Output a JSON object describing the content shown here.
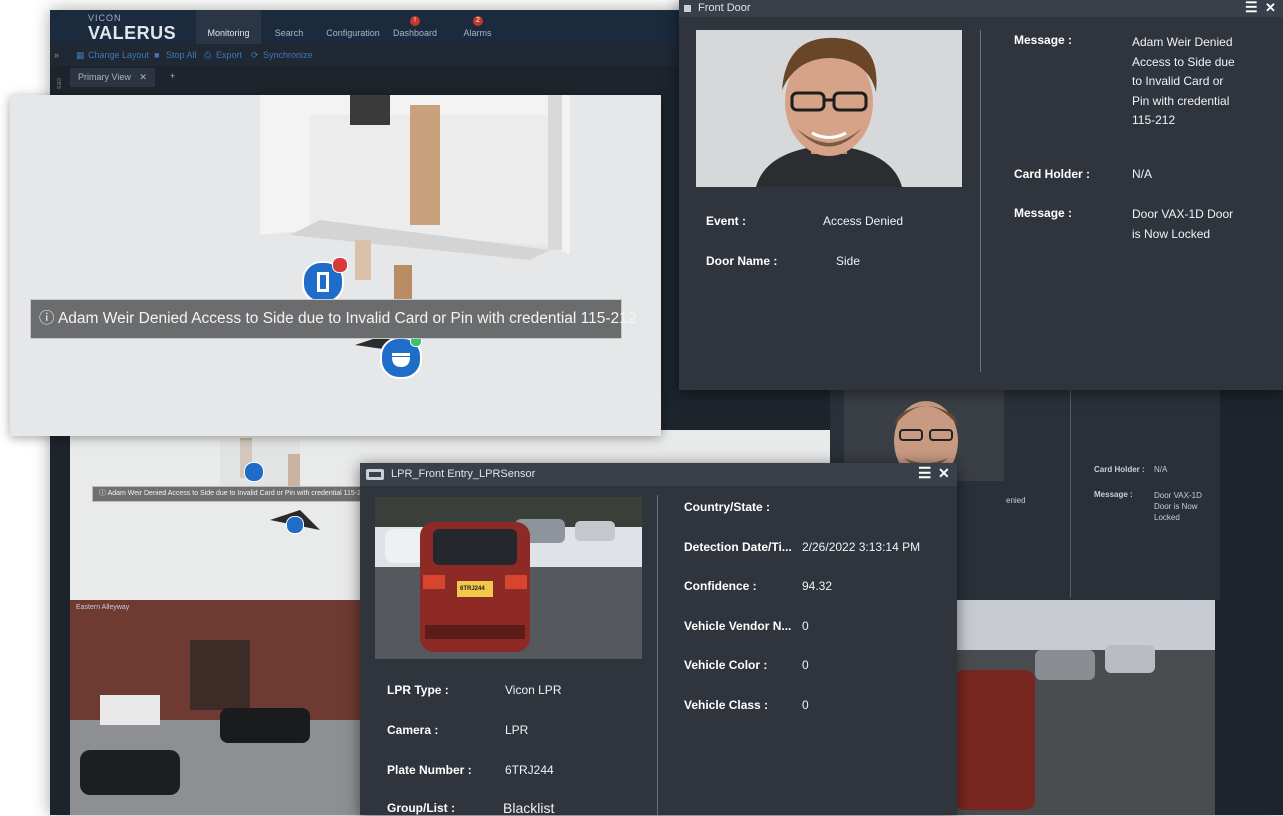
{
  "app": {
    "brand_top": "VICON",
    "brand_main": "VALERUS",
    "nav": [
      "Monitoring",
      "Search",
      "Configuration",
      "Dashboard",
      "Alarms"
    ],
    "alarm_count": "2",
    "toolbar": [
      "Change Layout",
      "Stop All",
      "Export",
      "Synchronize"
    ],
    "view_tab": "Primary View",
    "camera_label": "Eastern Alleyway",
    "side_label": "ces"
  },
  "map": {
    "tooltip": "Adam Weir Denied Access to Side due to Invalid Card or Pin with credential 115-212"
  },
  "bg_panel": {
    "msg_value": "Side due to Invalid Card or Pin with credential 115-212",
    "card_holder_label": "Card Holder :",
    "card_holder_value": "N/A",
    "message_label": "Message :",
    "message_value": "Door VAX-1D Door is Now Locked",
    "partial_text": "enied"
  },
  "front_door": {
    "title": "Front Door",
    "event_label": "Event :",
    "event_value": "Access Denied",
    "door_name_label": "Door Name :",
    "door_name_value": "Side",
    "message_label": "Message :",
    "message_value": "Adam Weir Denied Access to Side due to Invalid Card or Pin with credential 115-212",
    "card_holder_label": "Card Holder :",
    "card_holder_value": "N/A",
    "message2_label": "Message :",
    "message2_value": "Door VAX-1D Door is Now Locked"
  },
  "lpr": {
    "title": "LPR_Front Entry_LPRSensor",
    "plate_on_photo": "6TRJ244",
    "left_fields": [
      {
        "label": "LPR Type :",
        "value": "Vicon LPR"
      },
      {
        "label": "Camera :",
        "value": "LPR"
      },
      {
        "label": "Plate Number :",
        "value": "6TRJ244"
      },
      {
        "label": "Group/List :",
        "value": "Blacklist"
      }
    ],
    "right_fields": [
      {
        "label": "Country/State :",
        "value": ""
      },
      {
        "label": "Detection Date/Ti...",
        "value": "2/26/2022 3:13:14 PM"
      },
      {
        "label": "Confidence :",
        "value": "94.32"
      },
      {
        "label": "Vehicle Vendor N...",
        "value": "0"
      },
      {
        "label": "Vehicle Color :",
        "value": "0"
      },
      {
        "label": "Vehicle Class :",
        "value": "0"
      }
    ]
  },
  "icons": {
    "menu": "☰",
    "close": "✕",
    "info": "ⓘ"
  },
  "colors": {
    "panel_bg": "#2f343d",
    "topbar": "#1b2a3c",
    "accent_blue": "#1f6dc8",
    "alarm_red": "#c0392b"
  }
}
